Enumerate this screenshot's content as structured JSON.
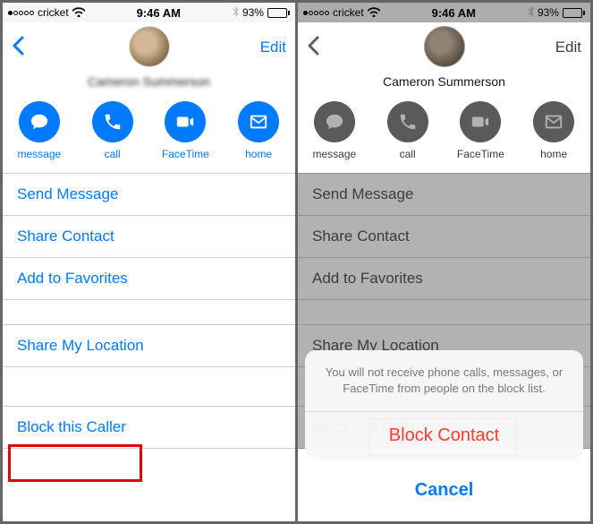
{
  "status": {
    "carrier": "cricket",
    "time": "9:46 AM",
    "battery_pct": "93%"
  },
  "nav": {
    "edit": "Edit"
  },
  "contact": {
    "name_blurred": "Cameron Summerson"
  },
  "actions": {
    "message": "message",
    "call": "call",
    "facetime": "FaceTime",
    "home": "home"
  },
  "menu": {
    "send_message": "Send Message",
    "share_contact": "Share Contact",
    "add_favorites": "Add to Favorites",
    "share_location": "Share My Location",
    "block_caller": "Block this Caller"
  },
  "sheet": {
    "message": "You will not receive phone calls, messages, or FaceTime from people on the block list.",
    "block": "Block Contact",
    "cancel": "Cancel"
  }
}
